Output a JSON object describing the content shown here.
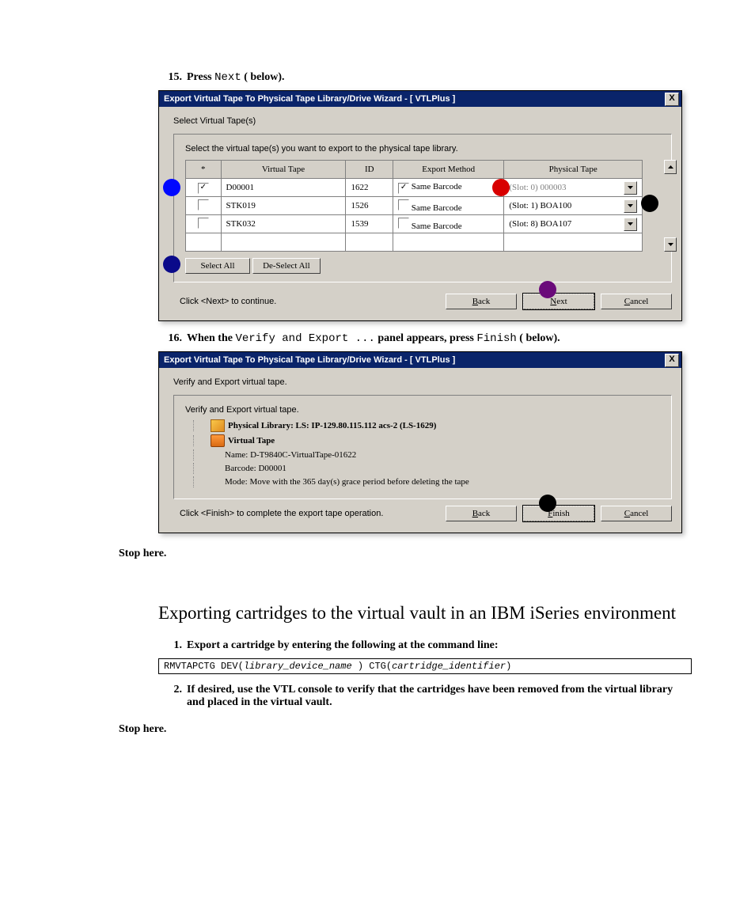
{
  "steps": {
    "s15": {
      "num": "15.",
      "pre": "Press ",
      "cmd": "Next",
      "post": " (   below)."
    },
    "s16": {
      "num": "16.",
      "pre": "When the ",
      "cmd": "Verify and Export ...",
      "mid": " panel appears, press ",
      "cmd2": "Finish",
      "post": " (   below)."
    },
    "s1": {
      "num": "1.",
      "text": "Export a cartridge by entering the following at the command line:"
    },
    "s2": {
      "num": "2.",
      "text": "If desired, use the VTL console to verify that the cartridges have been removed from the virtual library and placed in the virtual vault."
    }
  },
  "wiz1": {
    "title": "Export Virtual Tape To Physical Tape Library/Drive Wizard - [ VTLPlus ]",
    "heading": "Select Virtual Tape(s)",
    "instruction": "Select the virtual tape(s) you want to export to the physical tape library.",
    "cols": {
      "star": "*",
      "vt": "Virtual Tape",
      "id": "ID",
      "em": "Export Method",
      "pt": "Physical Tape"
    },
    "rows": [
      {
        "chk": true,
        "vt": "D00001",
        "id": "1622",
        "sb": true,
        "sblbl": "Same Barcode",
        "pt": "(Slot: 0) 000003",
        "gray": true
      },
      {
        "chk": false,
        "vt": "STK019",
        "id": "1526",
        "sb": false,
        "sblbl": "Same Barcode",
        "pt": "(Slot: 1) BOA100",
        "gray": false
      },
      {
        "chk": false,
        "vt": "STK032",
        "id": "1539",
        "sb": false,
        "sblbl": "Same Barcode",
        "pt": "(Slot: 8) BOA107",
        "gray": false
      }
    ],
    "selectAll": "Select All",
    "deselectAll": "De-Select All",
    "hint": "Click <Next> to continue.",
    "back": "Back",
    "next": "Next",
    "cancel": "Cancel"
  },
  "wiz2": {
    "title": "Export Virtual Tape To Physical Tape Library/Drive Wizard - [ VTLPlus ]",
    "heading": "Verify and Export virtual tape.",
    "groupHeading": "Verify and Export virtual tape.",
    "tree": {
      "lib": "Physical Library: LS: IP-129.80.115.112 acs-2 (LS-1629)",
      "vt": "Virtual Tape",
      "name": "Name: D-T9840C-VirtualTape-01622",
      "barcode": "Barcode: D00001",
      "mode": "Mode: Move with the 365 day(s) grace period before deleting the tape"
    },
    "hint": "Click <Finish> to complete the export tape operation.",
    "back": "Back",
    "finish": "Finish",
    "cancel": "Cancel"
  },
  "stopHere": "Stop here.",
  "sectionTitle": "Exporting cartridges to the virtual vault in an IBM iSeries environment",
  "cmd": {
    "a": "RMVTAPCTG DEV(",
    "b": "library_device_name",
    "c": " ) CTG(",
    "d": "cartridge_identifier",
    "e": ")"
  },
  "x": "X"
}
